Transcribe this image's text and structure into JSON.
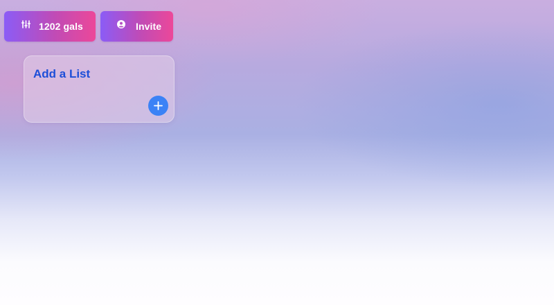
{
  "toolbar": {
    "gals_button": {
      "label": "1202 gals",
      "icon": "sliders-icon"
    },
    "invite_button": {
      "label": "Invite",
      "icon": "user-circle-icon"
    }
  },
  "add_list_card": {
    "title": "Add a List",
    "add_icon": "plus-icon"
  },
  "colors": {
    "button_gradient_start": "#8b5cf6",
    "button_gradient_end": "#ec4899",
    "card_title": "#1d4ed8",
    "add_button": "#3b82f6"
  }
}
